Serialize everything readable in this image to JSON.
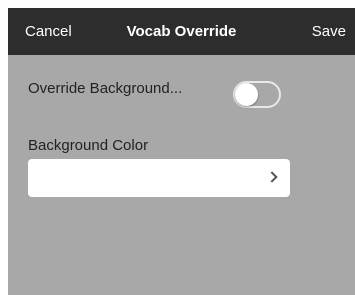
{
  "navbar": {
    "cancel_label": "Cancel",
    "title": "Vocab Override",
    "save_label": "Save"
  },
  "form": {
    "override_background_label": "Override Background...",
    "override_background_on": false,
    "background_color_label": "Background Color",
    "background_color_value": ""
  },
  "colors": {
    "navbar_bg": "#2d2d2d",
    "content_bg": "#a8a8a8",
    "field_bg": "#ffffff"
  }
}
